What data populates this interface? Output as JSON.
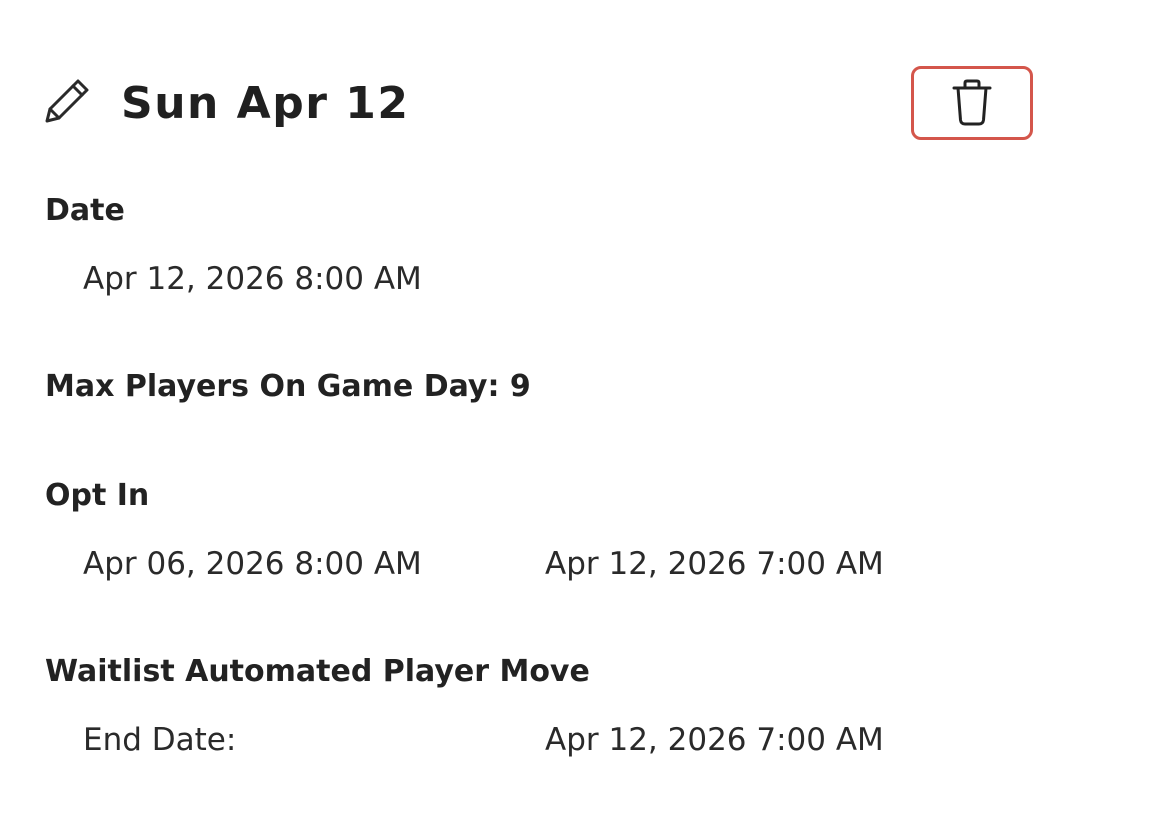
{
  "header": {
    "title": "Sun Apr 12",
    "edit_icon": "pencil-icon",
    "delete_icon": "trash-icon",
    "delete_border_color": "#d4564b"
  },
  "date_section": {
    "label": "Date",
    "value": "Apr 12, 2026 8:00 AM"
  },
  "max_players": {
    "text": "Max Players On Game Day: 9"
  },
  "opt_in": {
    "label": "Opt In",
    "start": "Apr 06, 2026 8:00 AM",
    "end": "Apr 12, 2026 7:00 AM"
  },
  "waitlist": {
    "label": "Waitlist Automated Player Move",
    "end_date_label": "End Date:",
    "end_date_value": "Apr 12, 2026 7:00 AM"
  }
}
